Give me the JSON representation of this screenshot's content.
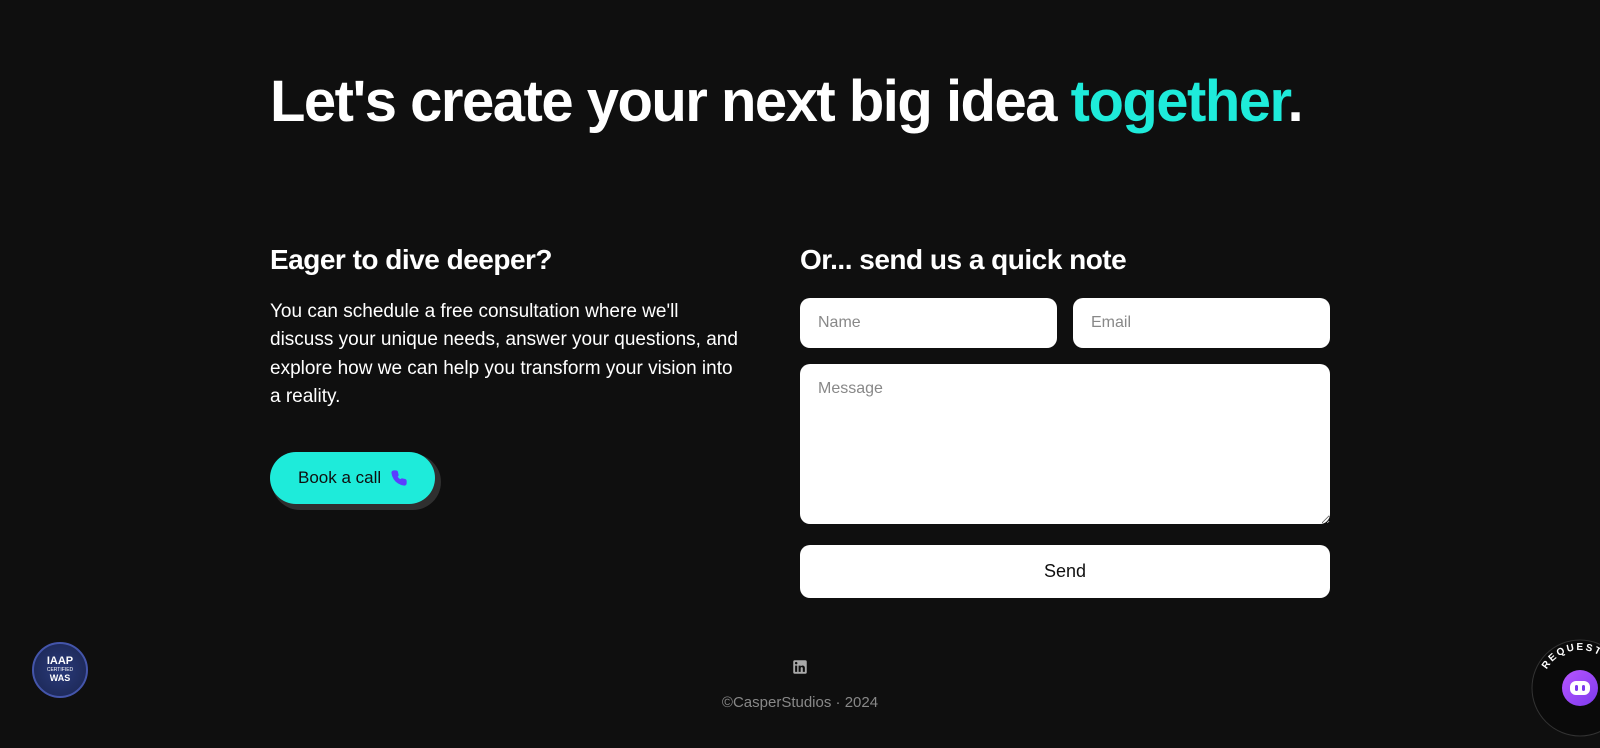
{
  "headline": {
    "prefix": "Let's create your next big idea ",
    "accent": "together",
    "suffix": "."
  },
  "left": {
    "heading": "Eager to dive deeper?",
    "description": "You can schedule a free consultation where we'll discuss your unique needs, answer your questions, and explore how we can help you transform your vision into a reality.",
    "cta_label": "Book a call"
  },
  "right": {
    "heading": "Or... send us a quick note",
    "name_placeholder": "Name",
    "email_placeholder": "Email",
    "message_placeholder": "Message",
    "send_label": "Send"
  },
  "footer": {
    "copyright": "©CasperStudios · 2024"
  },
  "badges": {
    "iaap_line1": "IAAP",
    "iaap_line2": "CERTIFIED",
    "iaap_line3": "WAS",
    "widget_text": "REQUEST FORM"
  },
  "colors": {
    "accent": "#1EEBDA",
    "background": "#0f0f0f"
  }
}
